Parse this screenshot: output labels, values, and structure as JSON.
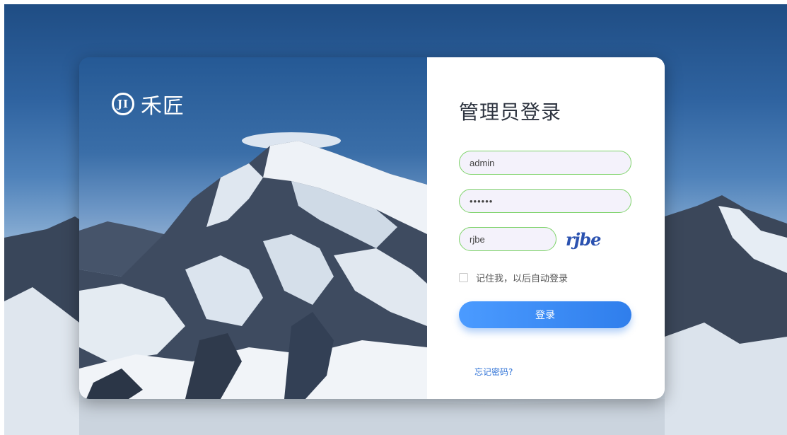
{
  "brand": {
    "logo_text": "JI",
    "name": "禾匠"
  },
  "login": {
    "title": "管理员登录",
    "username_value": "admin",
    "password_value": "••••••",
    "captcha_value": "rjbe",
    "captcha_image_text": "rjbe",
    "remember_label": "记住我，以后自动登录",
    "submit_label": "登录",
    "forgot_label": "忘记密码?"
  },
  "colors": {
    "accent": "#2f7eec",
    "input_border": "#7ed36a",
    "input_bg": "#f4f2fb",
    "link": "#2f72d6",
    "sky_top": "#1f4d84"
  }
}
